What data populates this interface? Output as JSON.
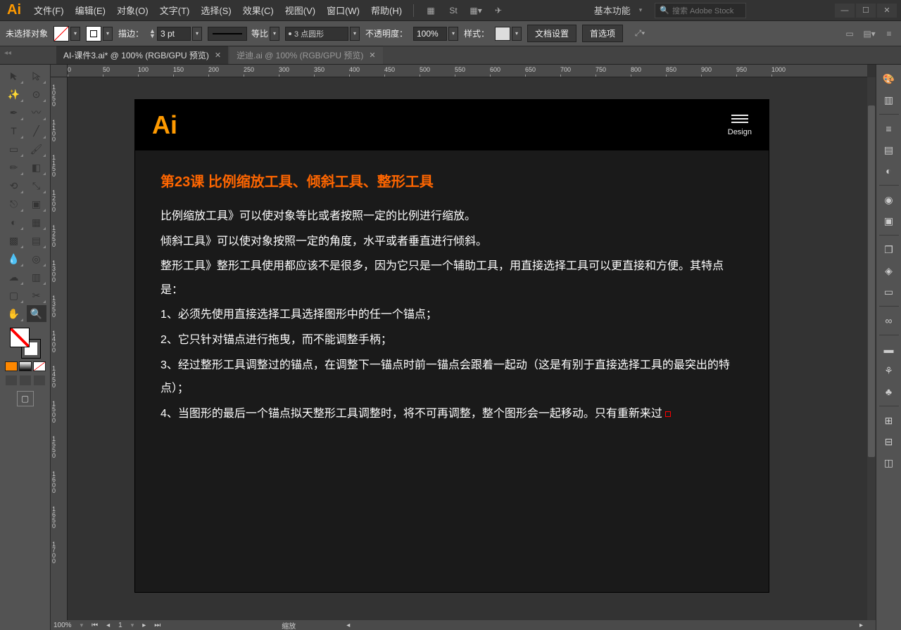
{
  "app": {
    "logo": "Ai"
  },
  "menu": [
    "文件(F)",
    "编辑(E)",
    "对象(O)",
    "文字(T)",
    "选择(S)",
    "效果(C)",
    "视图(V)",
    "窗口(W)",
    "帮助(H)"
  ],
  "workspace": {
    "label": "基本功能"
  },
  "search": {
    "placeholder": "搜索 Adobe Stock"
  },
  "optbar": {
    "noSelection": "未选择对象",
    "strokeLabel": "描边：",
    "strokeWidth": "3 pt",
    "scaleLabel": "等比",
    "dotLabel": "3 点圆形",
    "opacityLabel": "不透明度：",
    "opacityVal": "100%",
    "styleLabel": "样式：",
    "docSetup": "文档设置",
    "prefs": "首选项"
  },
  "tabs": [
    {
      "label": "AI-课件3.ai* @ 100% (RGB/GPU 预览)",
      "active": true
    },
    {
      "label": "逆迪.ai @ 100% (RGB/GPU 预览)",
      "active": false
    }
  ],
  "rulerH": [
    0,
    50,
    100,
    150,
    200,
    250,
    300,
    350,
    400,
    450,
    500,
    550,
    600,
    650,
    700,
    750,
    800,
    850,
    900,
    950,
    1000
  ],
  "rulerV": [
    1050,
    1100,
    1150,
    1200,
    1250,
    1300,
    1350,
    1400,
    1450,
    1500,
    1550,
    1600,
    1650,
    1700
  ],
  "artboard": {
    "logo": "Ai",
    "menuLabel": "Design",
    "title": "第23课   比例缩放工具、倾斜工具、整形工具",
    "paras": [
      "比例缩放工具》可以使对象等比或者按照一定的比例进行缩放。",
      "倾斜工具》可以使对象按照一定的角度，水平或者垂直进行倾斜。",
      "整形工具》整形工具使用都应该不是很多，因为它只是一个辅助工具，用直接选择工具可以更直接和方便。其特点是：",
      "1、必须先使用直接选择工具选择图形中的任一个锚点；",
      "2、它只针对锚点进行拖曳，而不能调整手柄；",
      "3、经过整形工具调整过的锚点，在调整下一锚点时前一锚点会跟着一起动（这是有别于直接选择工具的最突出的特点）；",
      "4、当图形的最后一个锚点拟天整形工具调整时，将不可再调整，整个图形会一起移动。只有重新来过"
    ]
  },
  "status": {
    "zoom": "100%",
    "angle": "1",
    "label": "缩放"
  },
  "miniColors": [
    "#ff8800",
    "#888888",
    "#ffffff"
  ],
  "miniGrad": "linear-gradient(to bottom right,#fff 0 48%,red 48% 52%,#fff 52%)"
}
